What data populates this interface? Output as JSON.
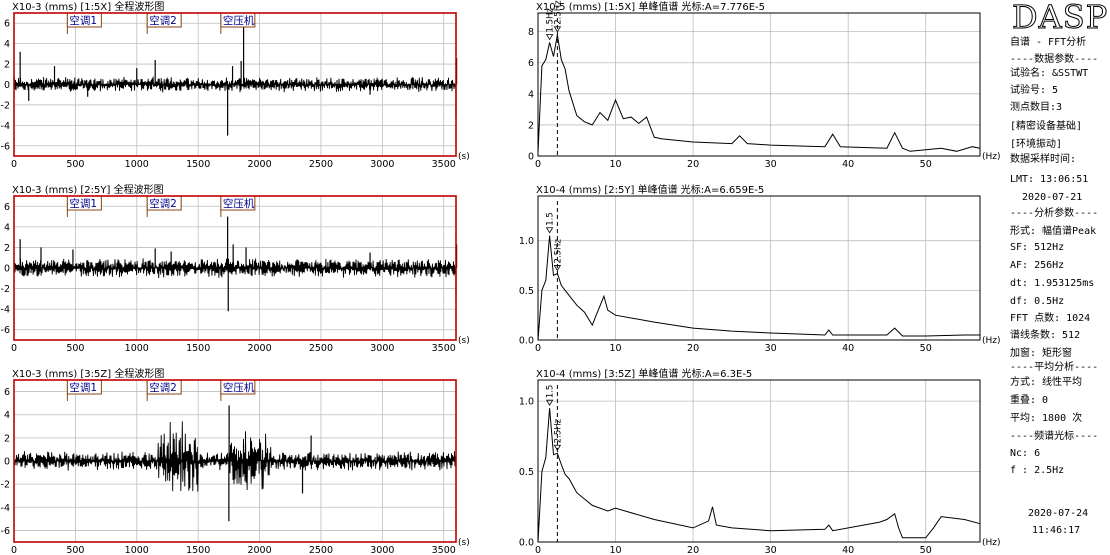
{
  "sidebar": {
    "logo": "DASP",
    "lines": [
      "自谱 - FFT分析",
      "----数据参数----",
      "试验名: &SSTWT",
      "试验号: 5",
      "测点数目:3",
      "[精密设备基础]",
      "[环境振动]",
      "数据采样时间:",
      "LMT: 13:06:51",
      "  2020-07-21",
      "----分析参数----",
      "形式: 幅值谱Peak",
      "SF: 512Hz",
      "AF: 256Hz",
      "dt: 1.953125ms",
      "df: 0.5Hz",
      "FFT 点数: 1024",
      "谱线条数: 512",
      "加窗: 矩形窗",
      "----平均分析----",
      "方式: 线性平均",
      "重叠: 0",
      "平均: 1800 次",
      "----频谱光标----",
      "Nc: 6",
      "f : 2.5Hz"
    ],
    "footer_date": "2020-07-24",
    "footer_time": "11:46:17"
  },
  "colors": {
    "wave_frame": "#c00000",
    "spec_frame": "#000000",
    "grid": "#bdbdbd",
    "marker_box": "#8b4513",
    "marker_text": "#00008b"
  },
  "chart_data": [
    {
      "type": "line",
      "kind": "waveform",
      "title": "X10-3 (mms) [1:5X] 全程波形图",
      "xunit": "(s)",
      "xlim": [
        0,
        3600
      ],
      "ylim": [
        -7,
        7
      ],
      "xticks": [
        0,
        500,
        1000,
        1500,
        2000,
        2500,
        3000,
        3500
      ],
      "yticks": [
        -6,
        -4,
        -2,
        0,
        2,
        4,
        6
      ],
      "markers": [
        {
          "label": "空调1",
          "x": 500
        },
        {
          "label": "空调2",
          "x": 1150
        },
        {
          "label": "空压机",
          "x": 1750
        }
      ],
      "noise_amp": 0.8,
      "spikes": [
        [
          50,
          3.2
        ],
        [
          120,
          -1.6
        ],
        [
          330,
          1.8
        ],
        [
          600,
          -1.2
        ],
        [
          1000,
          1.6
        ],
        [
          1150,
          2.4
        ],
        [
          1740,
          -5.0
        ],
        [
          1780,
          1.8
        ],
        [
          1850,
          2.3
        ],
        [
          1870,
          6.0
        ],
        [
          2900,
          -1.0
        ],
        [
          3600,
          -3.0
        ],
        [
          3605,
          2.6
        ]
      ],
      "bursts": []
    },
    {
      "type": "line",
      "kind": "waveform",
      "title": "X10-3 (mms) [2:5Y] 全程波形图",
      "xunit": "(s)",
      "xlim": [
        0,
        3600
      ],
      "ylim": [
        -7,
        7
      ],
      "xticks": [
        0,
        500,
        1000,
        1500,
        2000,
        2500,
        3000,
        3500
      ],
      "yticks": [
        -6,
        -4,
        -2,
        0,
        2,
        4,
        6
      ],
      "markers": [
        {
          "label": "空调1",
          "x": 500
        },
        {
          "label": "空调2",
          "x": 1150
        },
        {
          "label": "空压机",
          "x": 1750
        }
      ],
      "noise_amp": 1.0,
      "spikes": [
        [
          50,
          2.8
        ],
        [
          220,
          2.0
        ],
        [
          480,
          1.8
        ],
        [
          1150,
          1.9
        ],
        [
          1280,
          1.6
        ],
        [
          1740,
          5.0
        ],
        [
          1745,
          -4.2
        ],
        [
          1785,
          2.3
        ],
        [
          1890,
          2.0
        ],
        [
          2900,
          1.5
        ],
        [
          3600,
          -2.6
        ],
        [
          3605,
          2.3
        ]
      ],
      "bursts": []
    },
    {
      "type": "line",
      "kind": "waveform",
      "title": "X10-3 (mms) [3:5Z] 全程波形图",
      "xunit": "(s)",
      "xlim": [
        0,
        3600
      ],
      "ylim": [
        -7,
        7
      ],
      "xticks": [
        0,
        500,
        1000,
        1500,
        2000,
        2500,
        3000,
        3500
      ],
      "yticks": [
        -6,
        -4,
        -2,
        0,
        2,
        4,
        6
      ],
      "markers": [
        {
          "label": "空调1",
          "x": 500
        },
        {
          "label": "空调2",
          "x": 1150
        },
        {
          "label": "空压机",
          "x": 1750
        }
      ],
      "noise_amp": 0.9,
      "spikes": [
        [
          1750,
          -5.2
        ],
        [
          1752,
          4.8
        ],
        [
          2350,
          -2.8
        ],
        [
          2420,
          2.2
        ]
      ],
      "bursts": [
        [
          1150,
          1500,
          3.6
        ],
        [
          1750,
          2100,
          2.8
        ]
      ]
    },
    {
      "type": "line",
      "kind": "spectrum",
      "title": "X10-5 (mms) [1:5X] 单峰值谱 光标:A=7.776E-5",
      "xunit": "(Hz)",
      "xlim": [
        0,
        57
      ],
      "ylim": [
        0,
        9.2
      ],
      "xticks": [
        0,
        10,
        20,
        30,
        40,
        50
      ],
      "yticks": [
        0,
        2,
        4,
        6,
        8
      ],
      "cursor_hz": 2.5,
      "peak_labels": [
        {
          "x": 1.5,
          "label": "1.5Hz"
        },
        {
          "x": 2.5,
          "label": "2.5Hz"
        }
      ],
      "x": [
        0,
        0.5,
        1,
        1.5,
        2,
        2.5,
        3,
        3.5,
        4,
        5,
        6,
        7,
        8,
        9,
        10,
        11,
        12,
        13,
        14,
        15,
        16,
        20,
        25,
        26,
        27,
        30,
        37,
        38,
        39,
        45,
        46,
        47,
        48,
        50,
        52,
        54,
        56,
        57
      ],
      "y": [
        0.2,
        5.8,
        6.2,
        7.3,
        6.4,
        7.8,
        6.2,
        5.6,
        4.2,
        2.6,
        2.2,
        2.0,
        2.8,
        2.3,
        3.6,
        2.4,
        2.5,
        2.1,
        2.5,
        1.2,
        1.1,
        0.9,
        0.8,
        1.3,
        0.8,
        0.7,
        0.6,
        1.4,
        0.6,
        0.5,
        1.5,
        0.5,
        0.3,
        0.4,
        0.5,
        0.3,
        0.6,
        0.5
      ]
    },
    {
      "type": "line",
      "kind": "spectrum",
      "title": "X10-4 (mms) [2:5Y] 单峰值谱 光标:A=6.659E-5",
      "xunit": "(Hz)",
      "xlim": [
        0,
        57
      ],
      "ylim": [
        0,
        1.45
      ],
      "xticks": [
        0,
        10,
        20,
        30,
        40,
        50
      ],
      "yticks": [
        0,
        0.5,
        1.0
      ],
      "ytick_labels": [
        "0.0",
        "0.5",
        "1.0"
      ],
      "cursor_hz": 2.5,
      "peak_labels": [
        {
          "x": 1.5,
          "label": "1.5"
        },
        {
          "x": 2.5,
          "label": "2.5Hz"
        }
      ],
      "x": [
        0,
        0.5,
        1,
        1.5,
        2,
        2.5,
        3,
        3.5,
        4,
        5,
        6,
        7,
        7.5,
        8.5,
        9,
        10,
        15,
        20,
        25,
        30,
        37,
        37.5,
        38,
        45,
        46,
        47,
        50,
        55,
        57
      ],
      "y": [
        0.0,
        0.5,
        0.6,
        1.05,
        0.65,
        0.67,
        0.55,
        0.5,
        0.45,
        0.35,
        0.28,
        0.15,
        0.25,
        0.44,
        0.3,
        0.25,
        0.18,
        0.12,
        0.09,
        0.07,
        0.05,
        0.1,
        0.05,
        0.05,
        0.12,
        0.04,
        0.04,
        0.05,
        0.05
      ]
    },
    {
      "type": "line",
      "kind": "spectrum",
      "title": "X10-4 (mms) [3:5Z] 单峰值谱 光标:A=6.3E-5",
      "xunit": "(Hz)",
      "xlim": [
        0,
        57
      ],
      "ylim": [
        0,
        1.15
      ],
      "xticks": [
        0,
        10,
        20,
        30,
        40,
        50
      ],
      "yticks": [
        0,
        0.5,
        1.0
      ],
      "ytick_labels": [
        "0.0",
        "0.5",
        "1.0"
      ],
      "cursor_hz": 2.5,
      "peak_labels": [
        {
          "x": 1.5,
          "label": "1.5"
        },
        {
          "x": 2.5,
          "label": "2.5Hz"
        }
      ],
      "x": [
        0,
        0.5,
        1,
        1.5,
        2,
        2.5,
        3,
        3.5,
        4,
        5,
        7,
        9,
        10,
        15,
        20,
        22,
        22.5,
        23,
        25,
        30,
        37,
        37.5,
        38,
        44,
        45,
        46,
        46.5,
        47,
        50,
        51,
        52,
        55,
        57
      ],
      "y": [
        0.0,
        0.5,
        0.6,
        0.95,
        0.62,
        0.63,
        0.55,
        0.48,
        0.45,
        0.35,
        0.26,
        0.22,
        0.24,
        0.16,
        0.1,
        0.15,
        0.25,
        0.12,
        0.1,
        0.08,
        0.09,
        0.12,
        0.08,
        0.14,
        0.16,
        0.2,
        0.1,
        0.03,
        0.03,
        0.1,
        0.18,
        0.16,
        0.13
      ]
    }
  ]
}
